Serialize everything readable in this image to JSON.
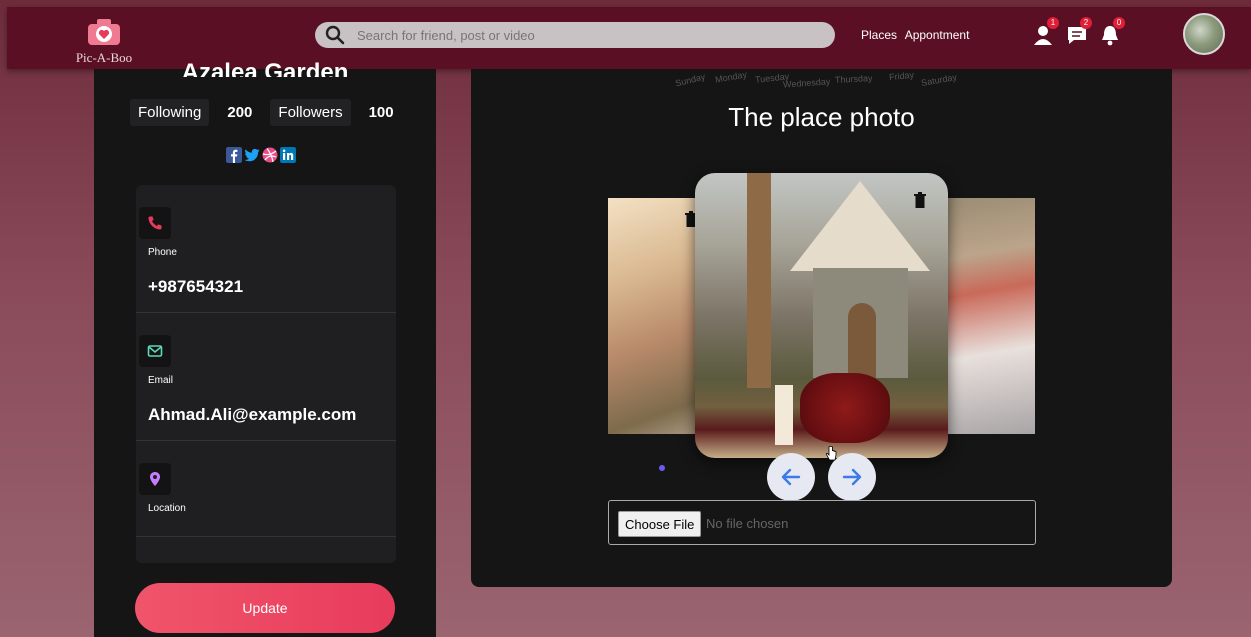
{
  "app": {
    "logo_text": "Pic-A-Boo",
    "brand_color": "#5a0f24",
    "accent": "#e83b5c"
  },
  "header": {
    "search_placeholder": "Search for friend, post or video",
    "links": [
      "Places",
      "Appontment"
    ],
    "notifications": {
      "friends": "1",
      "messages": "2",
      "alerts": "0"
    }
  },
  "profile": {
    "name": "Azalea Garden",
    "following_label": "Following",
    "following_count": "200",
    "followers_label": "Followers",
    "followers_count": "100",
    "socials": [
      "facebook-icon",
      "twitter-icon",
      "dribbble-icon",
      "linkedin-icon"
    ],
    "contacts": [
      {
        "icon": "phone-icon",
        "label": "Phone",
        "value": "+987654321",
        "color": "#e83b5c"
      },
      {
        "icon": "mail-icon",
        "label": "Email",
        "value": "Ahmad.Ali@example.com",
        "color": "#5fd6b5"
      },
      {
        "icon": "location-icon",
        "label": "Location",
        "value": "",
        "color": "#c77dff"
      }
    ],
    "update_label": "Update"
  },
  "place": {
    "weekdays": [
      "Sunday",
      "Monday",
      "Tuesday",
      "Wednesday",
      "Thursday",
      "Friday",
      "Saturday"
    ],
    "title": "The place photo",
    "file_button": "Choose File",
    "file_status": "No file chosen"
  }
}
